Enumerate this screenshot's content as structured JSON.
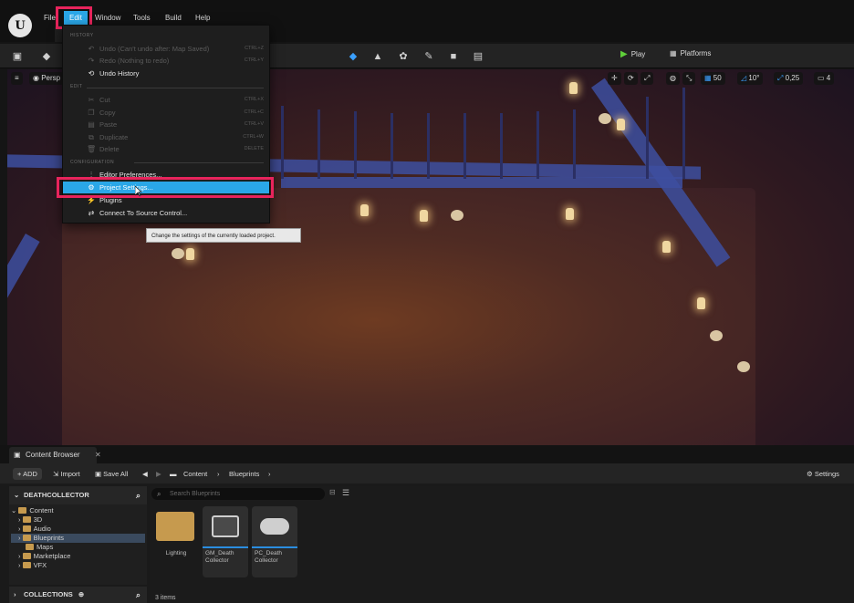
{
  "menubar": {
    "items": [
      {
        "label": "File"
      },
      {
        "label": "Edit"
      },
      {
        "label": "Window"
      },
      {
        "label": "Tools"
      },
      {
        "label": "Build"
      },
      {
        "label": "Help"
      }
    ]
  },
  "toolbar": {
    "play_label": "Play",
    "platforms_label": "Platforms"
  },
  "viewport": {
    "perspective_label": "Persp",
    "grid_value": "50",
    "rotation_value": "10°",
    "scale_value": "0,25",
    "camera_speed": "4"
  },
  "edit_menu": {
    "section_history": "HISTORY",
    "section_edit": "EDIT",
    "section_configuration": "CONFIGURATION",
    "history_items": [
      {
        "label": "Undo (Can't undo after: Map Saved)",
        "shortcut": "CTRL+Z",
        "icon": "undo-icon"
      },
      {
        "label": "Redo (Nothing to redo)",
        "shortcut": "CTRL+Y",
        "icon": "redo-icon"
      },
      {
        "label": "Undo History",
        "shortcut": "",
        "icon": "history-icon"
      }
    ],
    "edit_items": [
      {
        "label": "Cut",
        "shortcut": "CTRL+X",
        "icon": "cut-icon"
      },
      {
        "label": "Copy",
        "shortcut": "CTRL+C",
        "icon": "copy-icon"
      },
      {
        "label": "Paste",
        "shortcut": "CTRL+V",
        "icon": "paste-icon"
      },
      {
        "label": "Duplicate",
        "shortcut": "CTRL+W",
        "icon": "duplicate-icon"
      },
      {
        "label": "Delete",
        "shortcut": "DELETE",
        "icon": "delete-icon"
      }
    ],
    "config_items": [
      {
        "label": "Editor Preferences...",
        "icon": "sliders-icon"
      },
      {
        "label": "Project Settings...",
        "icon": "gear-icon"
      },
      {
        "label": "Plugins",
        "icon": "plug-icon"
      },
      {
        "label": "Connect To Source Control...",
        "icon": "source-control-icon"
      }
    ],
    "tooltip": "Change the settings of the currently loaded project."
  },
  "content_browser": {
    "tab_label": "Content Browser",
    "add_label": "ADD",
    "import_label": "Import",
    "save_all_label": "Save All",
    "breadcrumb": [
      "Content",
      "Blueprints"
    ],
    "settings_label": "Settings",
    "sources_title": "DEATHCOLLECTOR",
    "tree": [
      {
        "label": "Content"
      },
      {
        "label": "3D"
      },
      {
        "label": "Audio"
      },
      {
        "label": "Blueprints"
      },
      {
        "label": "Maps"
      },
      {
        "label": "Marketplace"
      },
      {
        "label": "VFX"
      }
    ],
    "collections_label": "COLLECTIONS",
    "search_placeholder": "Search Blueprints",
    "assets": [
      {
        "label": "Lighting"
      },
      {
        "label": "GM_Death Collector"
      },
      {
        "label": "PC_Death Collector"
      }
    ],
    "items_count": "3 items"
  }
}
